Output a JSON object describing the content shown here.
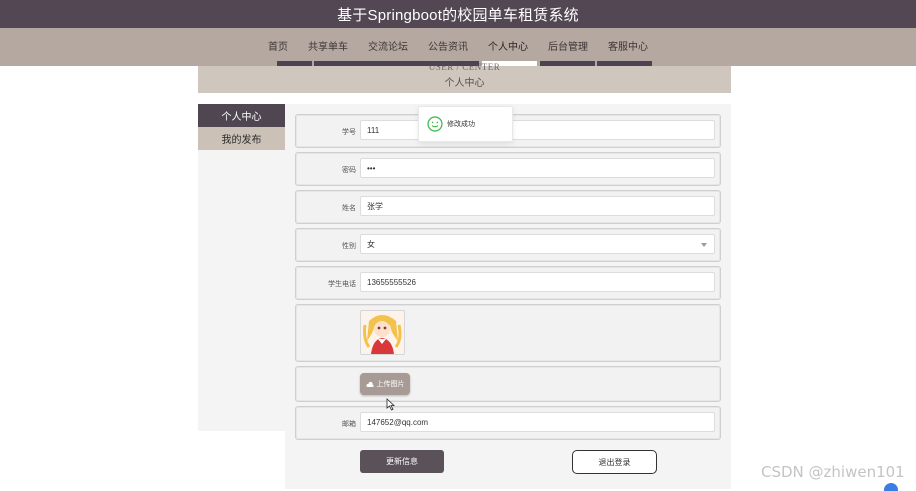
{
  "header": {
    "title": "基于Springboot的校园单车租赁系统"
  },
  "nav": {
    "items": [
      {
        "label": "首页"
      },
      {
        "label": "共享单车"
      },
      {
        "label": "交流论坛"
      },
      {
        "label": "公告资讯"
      },
      {
        "label": "个人中心",
        "active": true
      },
      {
        "label": "后台管理"
      },
      {
        "label": "客服中心"
      }
    ]
  },
  "banner": {
    "en": "USER / CENTER",
    "cn": "个人中心"
  },
  "sidebar": {
    "items": [
      {
        "label": "个人中心",
        "active": true
      },
      {
        "label": "我的发布"
      }
    ]
  },
  "toast": {
    "message": "修改成功",
    "icon": "check-circle-icon"
  },
  "form": {
    "student_id": {
      "label": "学号",
      "value": "111"
    },
    "password": {
      "label": "密码",
      "value": "•••"
    },
    "name": {
      "label": "姓名",
      "value": "张学"
    },
    "gender": {
      "label": "性别",
      "value": "女"
    },
    "phone": {
      "label": "学生电话",
      "value": "13655555526"
    },
    "avatar_icon": "anime-avatar-image",
    "upload_label": "上传图片",
    "email": {
      "label": "邮箱",
      "value": "147652@qq.com"
    }
  },
  "buttons": {
    "save": "更新信息",
    "logout": "退出登录"
  },
  "watermark": "CSDN @zhiwen101",
  "colors": {
    "dark": "#524753",
    "accent": "#b4a8a0",
    "success": "#3bb54a"
  }
}
